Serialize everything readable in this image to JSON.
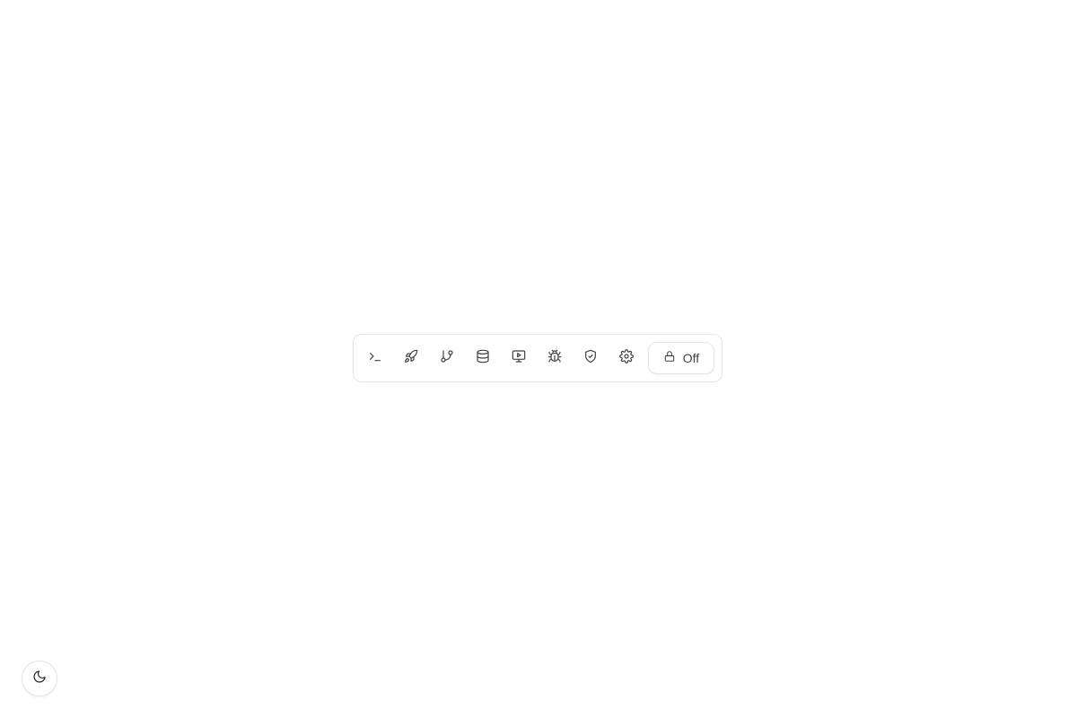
{
  "toolbar": {
    "buttons": [
      {
        "icon": "terminal-icon",
        "name": "terminal-button"
      },
      {
        "icon": "rocket-icon",
        "name": "deploy-button"
      },
      {
        "icon": "git-branch-icon",
        "name": "git-branch-button"
      },
      {
        "icon": "database-icon",
        "name": "database-button"
      },
      {
        "icon": "monitor-play-icon",
        "name": "preview-button"
      },
      {
        "icon": "bug-icon",
        "name": "debug-button"
      },
      {
        "icon": "shield-check-icon",
        "name": "security-button"
      },
      {
        "icon": "gear-icon",
        "name": "settings-button"
      }
    ],
    "lock": {
      "icon": "lock-icon",
      "label": "Off"
    }
  },
  "theme_toggle": {
    "icon": "moon-icon"
  },
  "colors": {
    "background": "#ffffff",
    "border": "#e4e4e7",
    "icon": "#3f3f46"
  }
}
